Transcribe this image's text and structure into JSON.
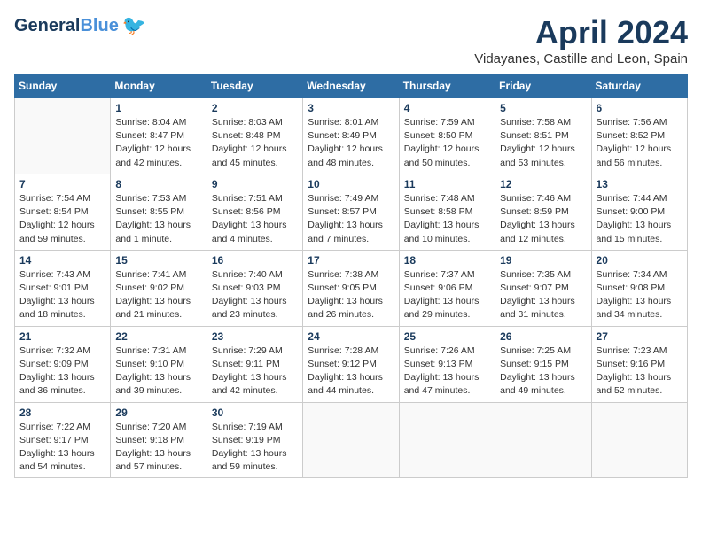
{
  "header": {
    "logo_line1": "General",
    "logo_line2": "Blue",
    "month": "April 2024",
    "location": "Vidayanes, Castille and Leon, Spain"
  },
  "weekdays": [
    "Sunday",
    "Monday",
    "Tuesday",
    "Wednesday",
    "Thursday",
    "Friday",
    "Saturday"
  ],
  "weeks": [
    [
      {
        "day": "",
        "info": ""
      },
      {
        "day": "1",
        "info": "Sunrise: 8:04 AM\nSunset: 8:47 PM\nDaylight: 12 hours\nand 42 minutes."
      },
      {
        "day": "2",
        "info": "Sunrise: 8:03 AM\nSunset: 8:48 PM\nDaylight: 12 hours\nand 45 minutes."
      },
      {
        "day": "3",
        "info": "Sunrise: 8:01 AM\nSunset: 8:49 PM\nDaylight: 12 hours\nand 48 minutes."
      },
      {
        "day": "4",
        "info": "Sunrise: 7:59 AM\nSunset: 8:50 PM\nDaylight: 12 hours\nand 50 minutes."
      },
      {
        "day": "5",
        "info": "Sunrise: 7:58 AM\nSunset: 8:51 PM\nDaylight: 12 hours\nand 53 minutes."
      },
      {
        "day": "6",
        "info": "Sunrise: 7:56 AM\nSunset: 8:52 PM\nDaylight: 12 hours\nand 56 minutes."
      }
    ],
    [
      {
        "day": "7",
        "info": "Sunrise: 7:54 AM\nSunset: 8:54 PM\nDaylight: 12 hours\nand 59 minutes."
      },
      {
        "day": "8",
        "info": "Sunrise: 7:53 AM\nSunset: 8:55 PM\nDaylight: 13 hours\nand 1 minute."
      },
      {
        "day": "9",
        "info": "Sunrise: 7:51 AM\nSunset: 8:56 PM\nDaylight: 13 hours\nand 4 minutes."
      },
      {
        "day": "10",
        "info": "Sunrise: 7:49 AM\nSunset: 8:57 PM\nDaylight: 13 hours\nand 7 minutes."
      },
      {
        "day": "11",
        "info": "Sunrise: 7:48 AM\nSunset: 8:58 PM\nDaylight: 13 hours\nand 10 minutes."
      },
      {
        "day": "12",
        "info": "Sunrise: 7:46 AM\nSunset: 8:59 PM\nDaylight: 13 hours\nand 12 minutes."
      },
      {
        "day": "13",
        "info": "Sunrise: 7:44 AM\nSunset: 9:00 PM\nDaylight: 13 hours\nand 15 minutes."
      }
    ],
    [
      {
        "day": "14",
        "info": "Sunrise: 7:43 AM\nSunset: 9:01 PM\nDaylight: 13 hours\nand 18 minutes."
      },
      {
        "day": "15",
        "info": "Sunrise: 7:41 AM\nSunset: 9:02 PM\nDaylight: 13 hours\nand 21 minutes."
      },
      {
        "day": "16",
        "info": "Sunrise: 7:40 AM\nSunset: 9:03 PM\nDaylight: 13 hours\nand 23 minutes."
      },
      {
        "day": "17",
        "info": "Sunrise: 7:38 AM\nSunset: 9:05 PM\nDaylight: 13 hours\nand 26 minutes."
      },
      {
        "day": "18",
        "info": "Sunrise: 7:37 AM\nSunset: 9:06 PM\nDaylight: 13 hours\nand 29 minutes."
      },
      {
        "day": "19",
        "info": "Sunrise: 7:35 AM\nSunset: 9:07 PM\nDaylight: 13 hours\nand 31 minutes."
      },
      {
        "day": "20",
        "info": "Sunrise: 7:34 AM\nSunset: 9:08 PM\nDaylight: 13 hours\nand 34 minutes."
      }
    ],
    [
      {
        "day": "21",
        "info": "Sunrise: 7:32 AM\nSunset: 9:09 PM\nDaylight: 13 hours\nand 36 minutes."
      },
      {
        "day": "22",
        "info": "Sunrise: 7:31 AM\nSunset: 9:10 PM\nDaylight: 13 hours\nand 39 minutes."
      },
      {
        "day": "23",
        "info": "Sunrise: 7:29 AM\nSunset: 9:11 PM\nDaylight: 13 hours\nand 42 minutes."
      },
      {
        "day": "24",
        "info": "Sunrise: 7:28 AM\nSunset: 9:12 PM\nDaylight: 13 hours\nand 44 minutes."
      },
      {
        "day": "25",
        "info": "Sunrise: 7:26 AM\nSunset: 9:13 PM\nDaylight: 13 hours\nand 47 minutes."
      },
      {
        "day": "26",
        "info": "Sunrise: 7:25 AM\nSunset: 9:15 PM\nDaylight: 13 hours\nand 49 minutes."
      },
      {
        "day": "27",
        "info": "Sunrise: 7:23 AM\nSunset: 9:16 PM\nDaylight: 13 hours\nand 52 minutes."
      }
    ],
    [
      {
        "day": "28",
        "info": "Sunrise: 7:22 AM\nSunset: 9:17 PM\nDaylight: 13 hours\nand 54 minutes."
      },
      {
        "day": "29",
        "info": "Sunrise: 7:20 AM\nSunset: 9:18 PM\nDaylight: 13 hours\nand 57 minutes."
      },
      {
        "day": "30",
        "info": "Sunrise: 7:19 AM\nSunset: 9:19 PM\nDaylight: 13 hours\nand 59 minutes."
      },
      {
        "day": "",
        "info": ""
      },
      {
        "day": "",
        "info": ""
      },
      {
        "day": "",
        "info": ""
      },
      {
        "day": "",
        "info": ""
      }
    ]
  ]
}
